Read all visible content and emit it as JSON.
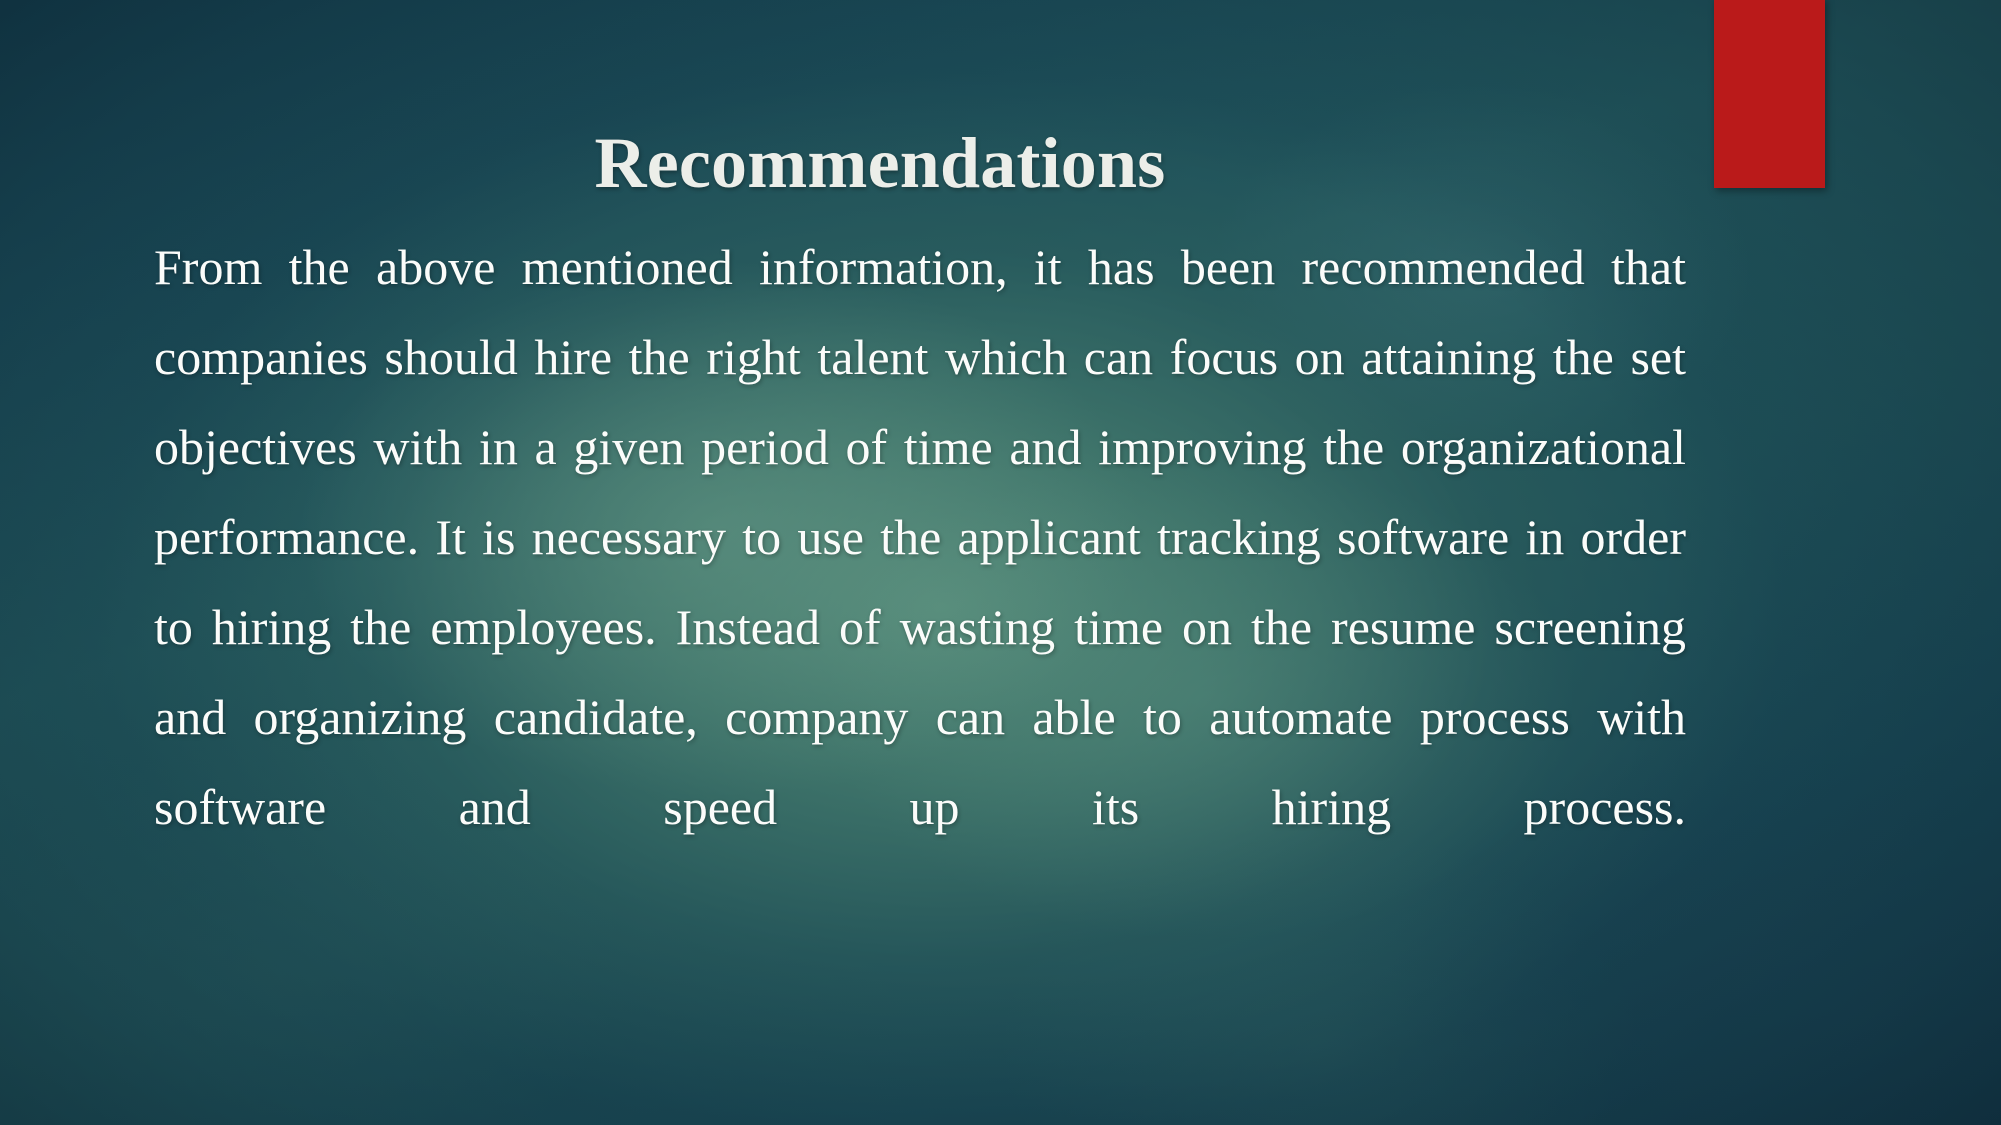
{
  "slide": {
    "title": "Recommendations",
    "body": "From the above mentioned information, it has been recommended that companies should hire the right talent which can focus on attaining the set objectives with in a given period of time and improving the organizational performance. It is necessary to use the applicant tracking software in order to hiring the employees. Instead of wasting time on the resume screening and organizing candidate, company can able to automate process with software and speed up its hiring process.",
    "body_lines": [
      "From the above mentioned information, it has been recommended that",
      "companies should hire the right talent which can focus on attaining the set",
      "objectives with in a given period of time and improving the organizational",
      "performance. It is necessary to use the applicant tracking software in order",
      "to hiring the employees. Instead of wasting time on the resume screening",
      "and organizing candidate, company can able to automate process with",
      "software and speed up its hiring process."
    ]
  },
  "colors": {
    "accent_red": "#ba1a1a",
    "background_dark_teal": "#15404f",
    "background_center_green": "#3c7368",
    "title_text": "#eceee9",
    "body_text": "#fbfcfa"
  }
}
